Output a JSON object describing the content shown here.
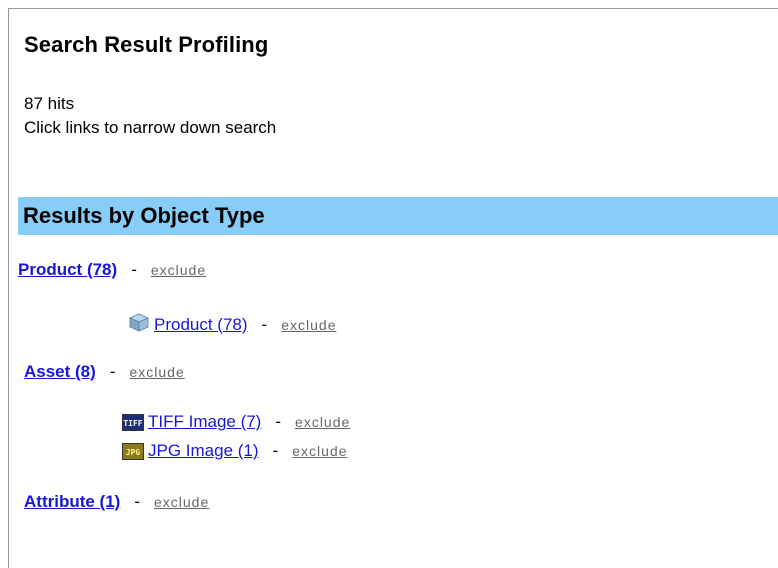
{
  "page": {
    "title": "Search Result Profiling",
    "hits": "87 hits",
    "hint": "Click links to narrow down search"
  },
  "section": {
    "header": "Results by Object Type"
  },
  "groups": [
    {
      "label": "Product (78)",
      "exclude": "exclude",
      "items": [
        {
          "icon": "cube-icon",
          "label": "Product (78)",
          "exclude": "exclude"
        }
      ]
    },
    {
      "label": "Asset (8)",
      "exclude": "exclude",
      "items": [
        {
          "icon": "tiff-file-icon",
          "icon_text": "TIFF",
          "label": "TIFF Image (7)",
          "exclude": "exclude"
        },
        {
          "icon": "jpg-file-icon",
          "icon_text": "JPG",
          "label": "JPG Image (1)",
          "exclude": "exclude"
        }
      ]
    },
    {
      "label": "Attribute (1)",
      "exclude": "exclude",
      "items": []
    }
  ],
  "separator": "-",
  "colors": {
    "section_header_bg": "#87cdf8",
    "link": "#1717d8",
    "exclude_link": "#666666"
  }
}
